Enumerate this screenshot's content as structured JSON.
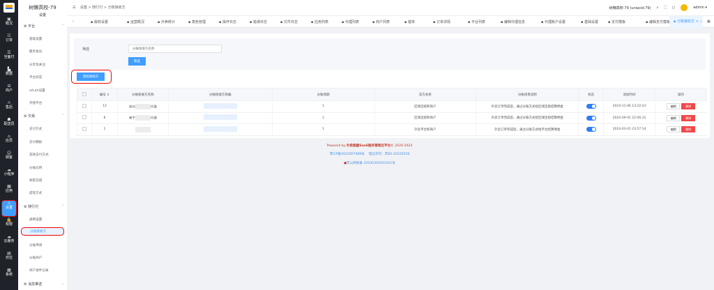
{
  "iconbar": [
    {
      "label": "概况"
    },
    {
      "label": "订单"
    },
    {
      "label": "当面付"
    },
    {
      "label": "数据"
    },
    {
      "label": "商户"
    },
    {
      "label": "售后"
    },
    {
      "label": "配送员"
    },
    {
      "label": "店员"
    },
    {
      "label": "顾客"
    },
    {
      "label": "小程序"
    },
    {
      "label": "应用"
    },
    {
      "label": "设置",
      "active": true
    },
    {
      "label": "权限"
    },
    {
      "label": "云服务"
    },
    {
      "label": "坊位"
    },
    {
      "label": "系统"
    }
  ],
  "sidebar": {
    "title": "树懒高校-79",
    "subtitle": "设置",
    "groups": [
      {
        "label": "平台",
        "items": [
          "基础设置",
          "服务协议",
          "分享及关注",
          "平台状态",
          "oAuth设置",
          "开放平台"
        ]
      },
      {
        "label": "交易",
        "items": [
          "支付方式",
          "支付模板",
          "其他支付方式",
          "分账比例",
          "顾客充值",
          "提现方式"
        ]
      },
      {
        "label": "随行付",
        "items": [
          "通用设置",
          "分账接收方",
          "分账申请",
          "分账商户",
          "商户进件记录"
        ]
      },
      {
        "label": "消息推送",
        "items": []
      }
    ],
    "active": "分账接收方"
  },
  "header": {
    "breadcrumb": [
      "设置",
      "随行付",
      "分账接收方"
    ],
    "store": "树懒高校-79 (uniacid:79)",
    "user": "admin"
  },
  "tabs": [
    "版权设置",
    "运营概况",
    "外卖统计",
    "角色管理",
    "操作日志",
    "错误日志",
    "文件日志",
    "应用列表",
    "代理列表",
    "商户列表",
    "催单",
    "订单详情",
    "平台列表",
    "编辑代理信息",
    "代理账户设置",
    "基础设置",
    "支付模板",
    "编辑支付模板",
    "分账接收方"
  ],
  "filter": {
    "label": "筛选",
    "placeholder": "分账接收方名称",
    "button": "筛选"
  },
  "add_button": "添加接收方",
  "table": {
    "headers": [
      "编号 ⇕",
      "分账接收方名称",
      "分账接收方商编",
      "分账周期",
      "双方关系",
      "分账场景说明",
      "状态",
      "添加时间",
      "操作"
    ],
    "rows": [
      {
        "id": "12",
        "name_pre": "泉州",
        "name_post": "代理",
        "cycle": "1",
        "relation": "区域连锁和商户",
        "desc": "外卖订单完成后，通过分账方式给区域连锁结算佣金",
        "status": true,
        "time": "2024-11-06 13:22:23"
      },
      {
        "id": "8",
        "name_pre": "南宁",
        "name_post": "代理",
        "cycle": "1",
        "relation": "区域连锁和商户",
        "desc": "外卖订单完成后，通过分账方式给区域连锁结算佣金",
        "status": true,
        "time": "2024-09-01 22:06:31"
      },
      {
        "id": "1",
        "name_pre": "",
        "name_post": "",
        "cycle": "1",
        "relation": "外卖平台和商户",
        "desc": "外卖订单完成后，通过分账方式给平台结算佣金",
        "status": true,
        "time": "2024-03-01 23:57:14"
      }
    ],
    "edit": "编辑",
    "delete": "删除"
  },
  "footer": {
    "powered": "Powered by ",
    "brand": "外卖跑腿SaaS服务管理云平台",
    "copy": "© 2020-2024",
    "icp": "苏ICP备2022007489号",
    "license": "电信许可：苏B2-20220556",
    "police": "苏公网安备 32030302001041号"
  }
}
